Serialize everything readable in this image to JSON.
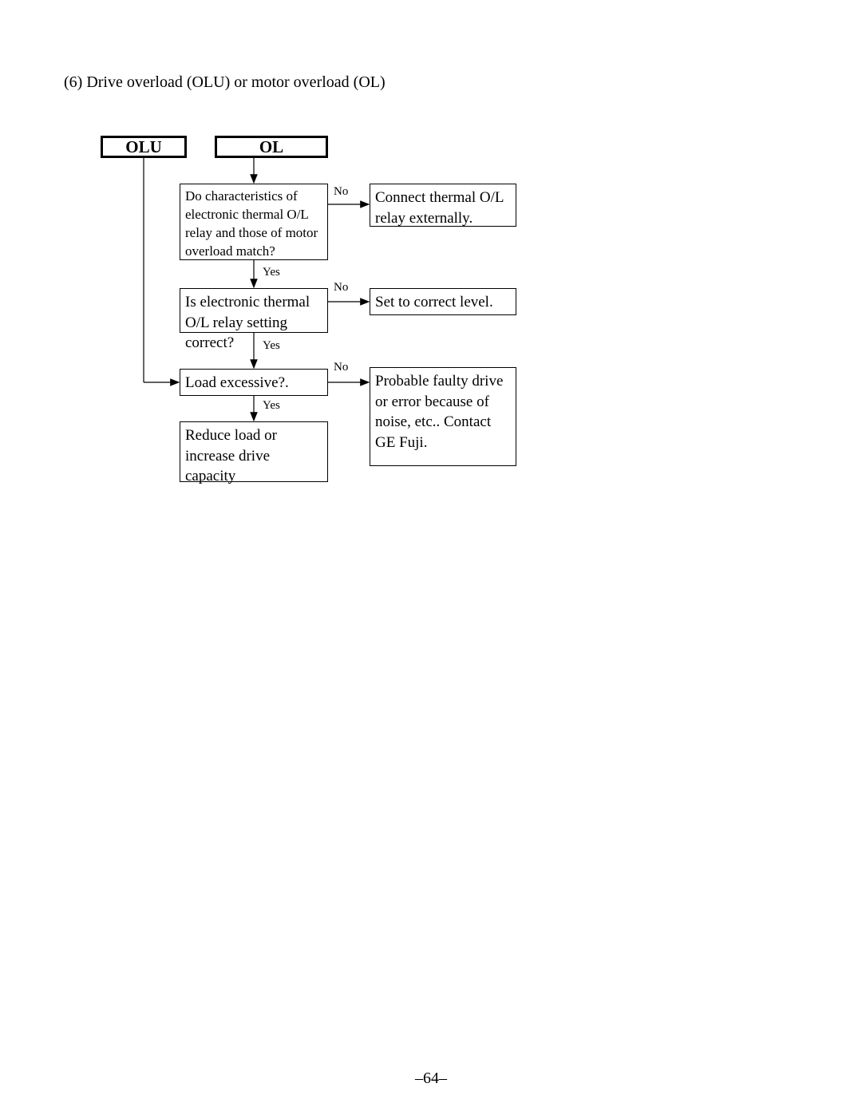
{
  "title": "(6) Drive overload (OLU) or motor overload (OL)",
  "page_number": "–64–",
  "nodes": {
    "olu": "OLU",
    "ol": "OL",
    "q1": "Do characteristics of electronic thermal O/L relay and those of motor overload match?",
    "a1": "Connect thermal O/L relay externally.",
    "q2": "Is electronic thermal O/L relay setting correct?",
    "a2": "Set to correct level.",
    "q3": "Load excessive?.",
    "a3": "Probable faulty drive or error because of noise, etc..  Contact GE Fuji.",
    "r3": "Reduce load or increase drive\ncapacity"
  },
  "labels": {
    "yes": "Yes",
    "no": "No"
  }
}
